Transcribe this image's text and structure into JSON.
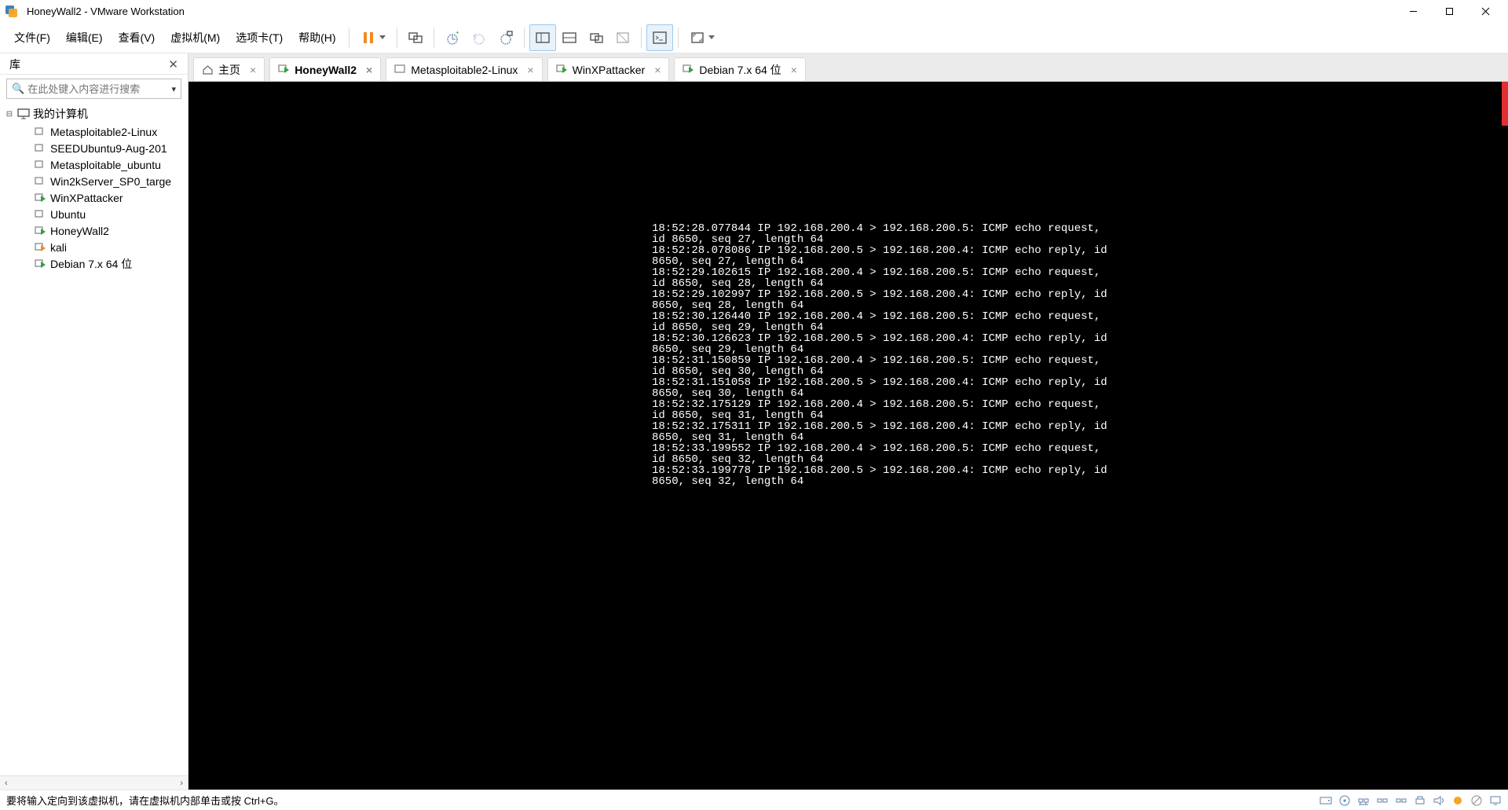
{
  "window": {
    "title": "HoneyWall2 - VMware Workstation"
  },
  "menus": {
    "file": "文件(F)",
    "edit": "编辑(E)",
    "view": "查看(V)",
    "vm": "虚拟机(M)",
    "tabs": "选项卡(T)",
    "help": "帮助(H)"
  },
  "sidebar": {
    "lib_label": "库",
    "search_placeholder": "在此处键入内容进行搜索",
    "root_label": "我的计算机",
    "items": [
      {
        "label": "Metasploitable2-Linux",
        "running": false
      },
      {
        "label": "SEEDUbuntu9-Aug-201",
        "running": false
      },
      {
        "label": "Metasploitable_ubuntu",
        "running": false
      },
      {
        "label": "Win2kServer_SP0_targe",
        "running": false
      },
      {
        "label": "WinXPattacker",
        "running": true
      },
      {
        "label": "Ubuntu",
        "running": false
      },
      {
        "label": "HoneyWall2",
        "running": true
      },
      {
        "label": "kali",
        "running": "orange"
      },
      {
        "label": "Debian 7.x 64 位",
        "running": true
      }
    ]
  },
  "tabs": [
    {
      "label": "主页",
      "kind": "home",
      "active": false
    },
    {
      "label": "HoneyWall2",
      "kind": "vm-run",
      "active": true
    },
    {
      "label": "Metasploitable2-Linux",
      "kind": "vm",
      "active": false
    },
    {
      "label": "WinXPattacker",
      "kind": "vm-run",
      "active": false
    },
    {
      "label": "Debian 7.x 64 位",
      "kind": "vm-run",
      "active": false
    }
  ],
  "console_lines": [
    "18:52:28.077844 IP 192.168.200.4 > 192.168.200.5: ICMP echo request, id 8650, seq 27, length 64",
    "18:52:28.078086 IP 192.168.200.5 > 192.168.200.4: ICMP echo reply, id 8650, seq 27, length 64",
    "18:52:29.102615 IP 192.168.200.4 > 192.168.200.5: ICMP echo request, id 8650, seq 28, length 64",
    "18:52:29.102997 IP 192.168.200.5 > 192.168.200.4: ICMP echo reply, id 8650, seq 28, length 64",
    "18:52:30.126440 IP 192.168.200.4 > 192.168.200.5: ICMP echo request, id 8650, seq 29, length 64",
    "18:52:30.126623 IP 192.168.200.5 > 192.168.200.4: ICMP echo reply, id 8650, seq 29, length 64",
    "18:52:31.150859 IP 192.168.200.4 > 192.168.200.5: ICMP echo request, id 8650, seq 30, length 64",
    "18:52:31.151058 IP 192.168.200.5 > 192.168.200.4: ICMP echo reply, id 8650, seq 30, length 64",
    "18:52:32.175129 IP 192.168.200.4 > 192.168.200.5: ICMP echo request, id 8650, seq 31, length 64",
    "18:52:32.175311 IP 192.168.200.5 > 192.168.200.4: ICMP echo reply, id 8650, seq 31, length 64",
    "18:52:33.199552 IP 192.168.200.4 > 192.168.200.5: ICMP echo request, id 8650, seq 32, length 64",
    "18:52:33.199778 IP 192.168.200.5 > 192.168.200.4: ICMP echo reply, id 8650, seq 32, length 64"
  ],
  "status": {
    "text": "要将输入定向到该虚拟机，请在虚拟机内部单击或按 Ctrl+G。"
  }
}
